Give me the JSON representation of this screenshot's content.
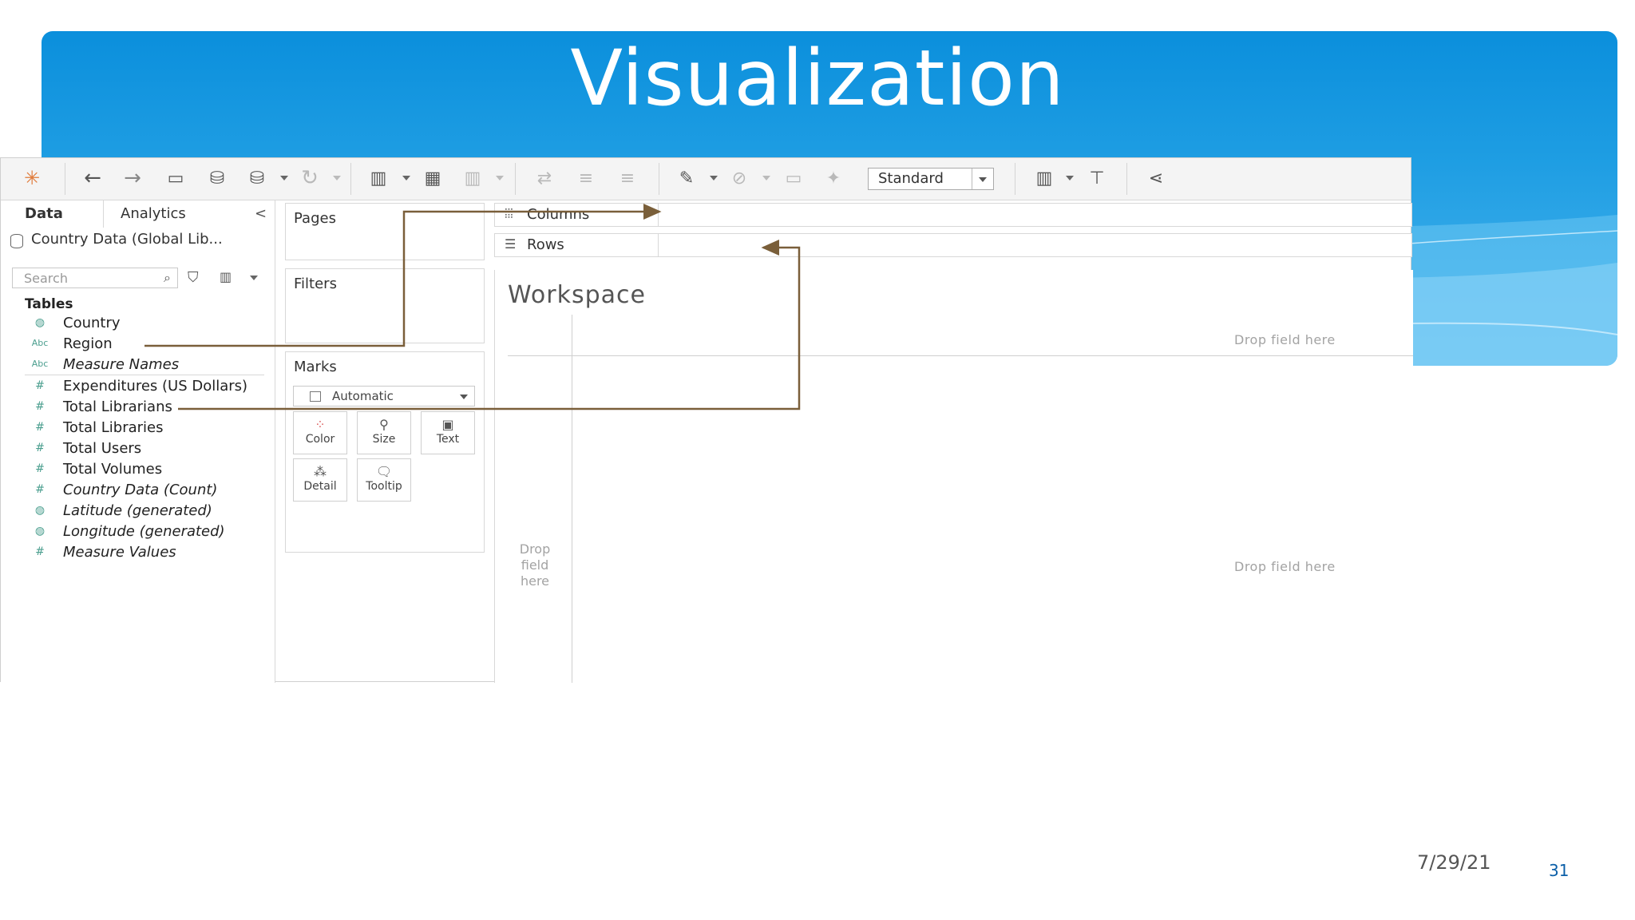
{
  "slide": {
    "title": "Visualization",
    "date": "7/29/21",
    "page_number": "31"
  },
  "toolbar": {
    "view_select": "Standard",
    "icons": [
      "tableau-logo-icon",
      "undo-icon",
      "redo-icon",
      "save-icon",
      "new-datasource-icon",
      "pause-updates-icon",
      "refresh-icon",
      "new-worksheet-icon",
      "duplicate-sheet-icon",
      "clear-sheet-icon",
      "swap-icon",
      "sort-ascending-icon",
      "sort-descending-icon",
      "highlight-icon",
      "group-icon",
      "show-labels-icon",
      "pin-icon",
      "show-me-icon",
      "presentation-icon",
      "share-icon"
    ]
  },
  "left_panel": {
    "tab_data": "Data",
    "tab_analytics": "Analytics",
    "datasource": "Country Data (Global Lib...",
    "search_placeholder": "Search",
    "tables_header": "Tables",
    "fields": [
      {
        "label": "Country",
        "type": "geo"
      },
      {
        "label": "Region",
        "type": "abc"
      },
      {
        "label": "Measure Names",
        "type": "abc"
      },
      {
        "label": "Expenditures  (US Dollars)",
        "type": "num"
      },
      {
        "label": "Total Librarians",
        "type": "num"
      },
      {
        "label": "Total Libraries",
        "type": "num"
      },
      {
        "label": "Total Users",
        "type": "num"
      },
      {
        "label": "Total Volumes",
        "type": "num"
      },
      {
        "label": "Country Data (Count)",
        "type": "num"
      },
      {
        "label": "Latitude (generated)",
        "type": "geo"
      },
      {
        "label": "Longitude (generated)",
        "type": "geo"
      },
      {
        "label": "Measure Values",
        "type": "num"
      }
    ],
    "abc_tag": "Abc"
  },
  "cards": {
    "pages": "Pages",
    "filters": "Filters",
    "marks": "Marks",
    "marks_type": "Automatic",
    "mark_buttons": [
      "Color",
      "Size",
      "Text",
      "Detail",
      "Tooltip"
    ]
  },
  "shelves": {
    "columns": "Columns",
    "rows": "Rows"
  },
  "workspace": {
    "title": "Workspace",
    "drop_top": "Drop field here",
    "drop_left_1": "Drop",
    "drop_left_2": "field",
    "drop_left_3": "here",
    "drop_center": "Drop field here"
  },
  "colors": {
    "banner": "#1a9be2",
    "arrow": "#7a5f3a"
  }
}
